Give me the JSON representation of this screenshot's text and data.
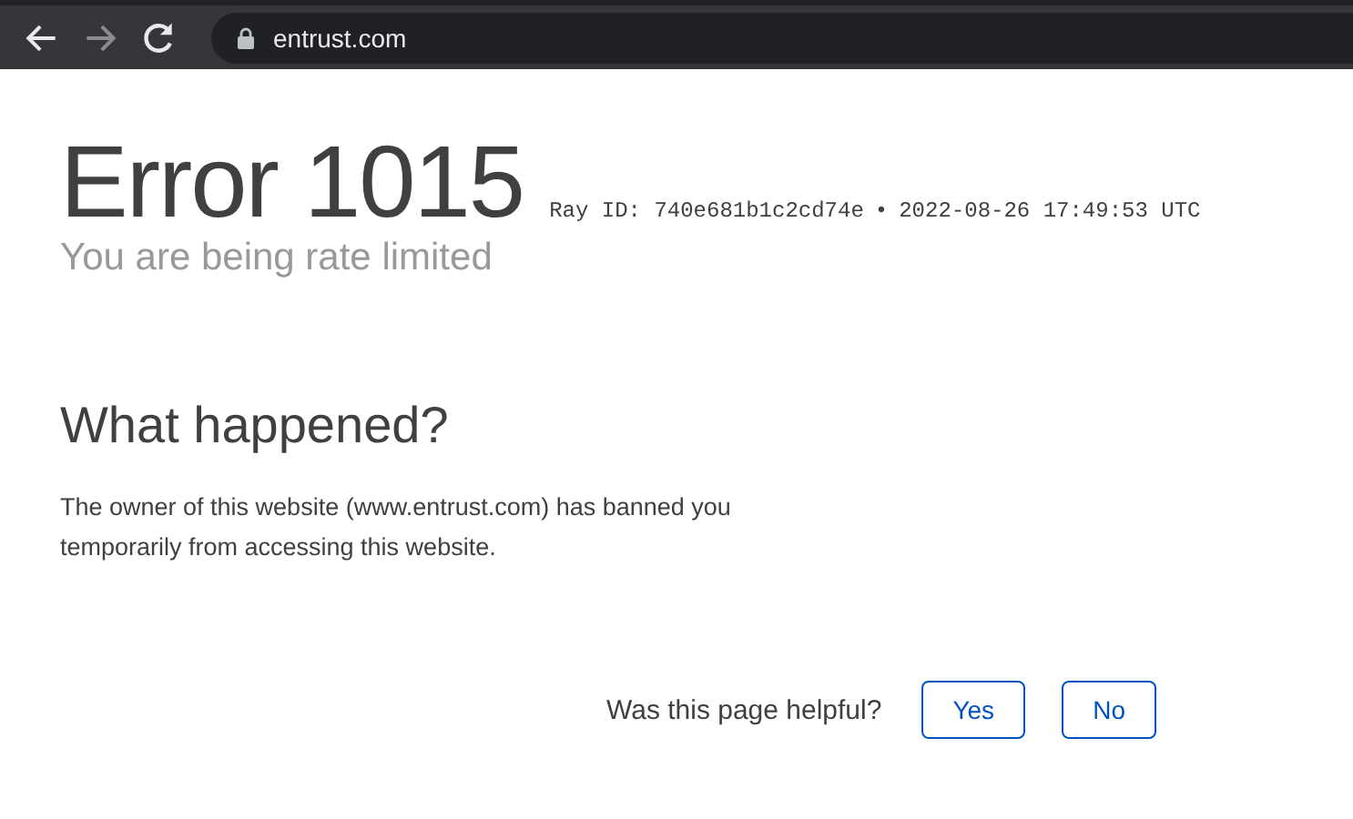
{
  "browser": {
    "url": "entrust.com",
    "forward_disabled": true
  },
  "error": {
    "title": "Error 1015",
    "ray_id": "Ray ID: 740e681b1c2cd74e",
    "separator": "•",
    "timestamp": "2022-08-26 17:49:53 UTC",
    "subtitle": "You are being rate limited"
  },
  "section": {
    "heading": "What happened?",
    "text": "The owner of this website (www.entrust.com) has banned you temporarily from accessing this website."
  },
  "feedback": {
    "question": "Was this page helpful?",
    "buttons": [
      "Yes",
      "No"
    ]
  }
}
